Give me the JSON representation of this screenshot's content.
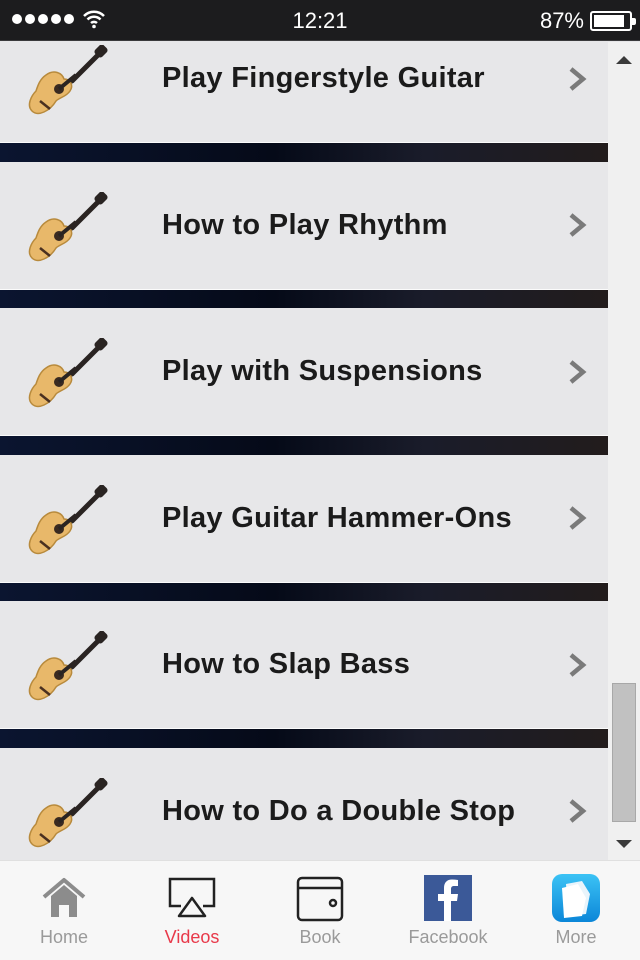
{
  "status_bar": {
    "signal_dots": 5,
    "time": "12:21",
    "battery_percent_label": "87%",
    "battery_level": 0.87
  },
  "list": {
    "items": [
      {
        "label": "Play Fingerstyle Guitar",
        "icon": "guitar-icon"
      },
      {
        "label": "How to Play Rhythm",
        "icon": "guitar-icon"
      },
      {
        "label": "Play with Suspensions",
        "icon": "guitar-icon"
      },
      {
        "label": "Play Guitar Hammer-Ons",
        "icon": "guitar-icon"
      },
      {
        "label": "How to Slap Bass",
        "icon": "guitar-icon"
      },
      {
        "label": "How to Do a Double Stop",
        "icon": "guitar-icon"
      }
    ]
  },
  "scrollbar": {
    "position": 0.98
  },
  "tabbar": {
    "tabs": [
      {
        "label": "Home",
        "icon": "home-icon",
        "active": false
      },
      {
        "label": "Videos",
        "icon": "airplay-icon",
        "active": true
      },
      {
        "label": "Book",
        "icon": "wallet-icon",
        "active": false
      },
      {
        "label": "Facebook",
        "icon": "facebook-icon",
        "active": false
      },
      {
        "label": "More",
        "icon": "more-pages-icon",
        "active": false
      }
    ],
    "active_color": "#e8394a",
    "facebook_color": "#3b5998",
    "more_color": "#1aa3e8"
  }
}
